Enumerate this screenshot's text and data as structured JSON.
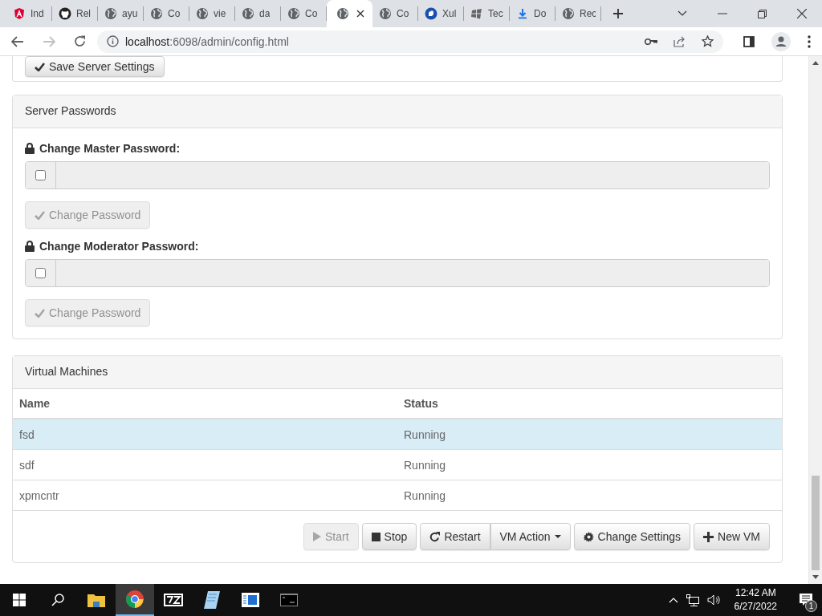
{
  "browser": {
    "tabs": [
      {
        "title": "Ind",
        "kind": "angular",
        "selected": false
      },
      {
        "title": "Rel",
        "kind": "github",
        "selected": false
      },
      {
        "title": "ayu",
        "kind": "globe",
        "selected": false
      },
      {
        "title": "Co",
        "kind": "globe",
        "selected": false
      },
      {
        "title": "vie",
        "kind": "globe",
        "selected": false
      },
      {
        "title": "da",
        "kind": "globe",
        "selected": false
      },
      {
        "title": "Co",
        "kind": "globe",
        "selected": false
      },
      {
        "kind": "globe",
        "selected": true
      },
      {
        "title": "Co",
        "kind": "globe",
        "selected": false
      },
      {
        "title": "Xul",
        "kind": "bluecircle",
        "selected": false
      },
      {
        "title": "Tec",
        "kind": "windows",
        "selected": false
      },
      {
        "title": "Do",
        "kind": "download",
        "selected": false
      },
      {
        "title": "Rec",
        "kind": "globe",
        "selected": false
      }
    ],
    "url_host": "localhost",
    "url_rest": ":6098/admin/config.html"
  },
  "page": {
    "save_button": "Save Server Settings",
    "passwords_panel": {
      "title": "Server Passwords",
      "fields": [
        {
          "label": "Change Master Password:",
          "checked": false,
          "button": "Change Password",
          "disabled": true
        },
        {
          "label": "Change Moderator Password:",
          "checked": false,
          "button": "Change Password",
          "disabled": true
        }
      ]
    },
    "vm_panel": {
      "title": "Virtual Machines",
      "columns": [
        "Name",
        "Status"
      ],
      "rows": [
        {
          "name": "fsd",
          "status": "Running",
          "selected": true
        },
        {
          "name": "sdf",
          "status": "Running",
          "selected": false
        },
        {
          "name": "xpmcntr",
          "status": "Running",
          "selected": false
        }
      ],
      "buttons": [
        {
          "label": "Start",
          "kind": "play",
          "disabled": true
        },
        {
          "label": "Stop",
          "kind": "stop",
          "disabled": false
        },
        {
          "label": "Restart",
          "kind": "restart",
          "disabled": false
        },
        {
          "label": "VM Action",
          "kind": "caret",
          "disabled": false
        },
        {
          "label": "Change Settings",
          "kind": "gear",
          "disabled": false
        },
        {
          "label": "New VM",
          "kind": "plus",
          "disabled": false
        }
      ]
    }
  },
  "taskbar": {
    "time": "12:42 AM",
    "date": "6/27/2022",
    "notifications": "1"
  }
}
